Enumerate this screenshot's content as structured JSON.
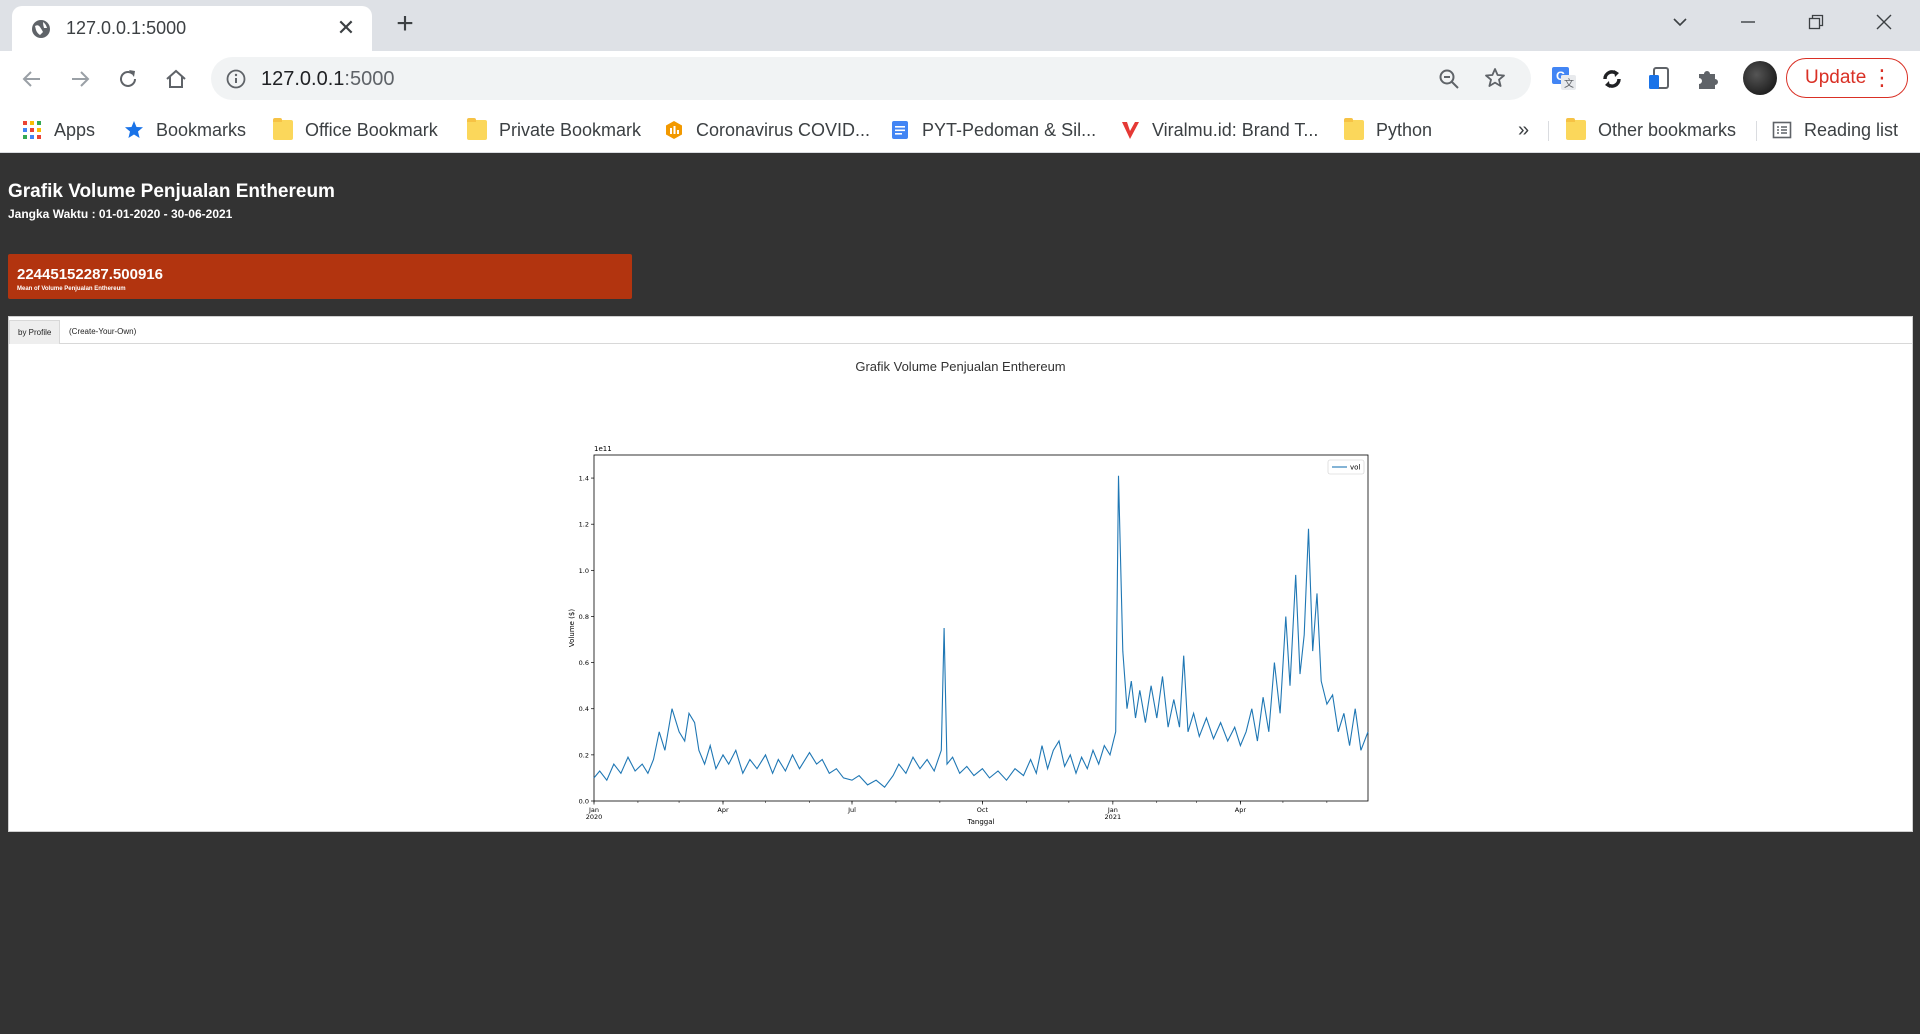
{
  "browser": {
    "tab_title": "127.0.0.1:5000",
    "url_host": "127.0.0.1",
    "url_port": ":5000",
    "update_label": "Update",
    "icons": {
      "favicon": "globe-icon",
      "close": "close-icon",
      "new_tab": "plus-icon",
      "back": "back-arrow-icon",
      "forward": "forward-arrow-icon",
      "reload": "reload-icon",
      "home": "home-icon",
      "info": "info-icon",
      "zoom": "zoom-out-icon",
      "star": "star-icon",
      "menu": "kebab-menu-icon"
    },
    "update_color": "#d93025"
  },
  "bookmarks": {
    "items": [
      {
        "label": "Apps",
        "icon": "apps-grid-icon"
      },
      {
        "label": "Bookmarks",
        "icon": "star-icon"
      },
      {
        "label": "Office Bookmark",
        "icon": "folder-icon"
      },
      {
        "label": "Private Bookmark",
        "icon": "folder-icon"
      },
      {
        "label": "Coronavirus COVID...",
        "icon": "dashboard-icon"
      },
      {
        "label": "PYT-Pedoman & Sil...",
        "icon": "docs-icon"
      },
      {
        "label": "Viralmu.id: Brand T...",
        "icon": "v-logo-icon"
      },
      {
        "label": "Python",
        "icon": "folder-icon"
      }
    ],
    "overflow": "»",
    "other": "Other bookmarks",
    "reading_list": "Reading list"
  },
  "page": {
    "title": "Grafik Volume Penjualan Enthereum",
    "subtitle": "Jangka Waktu : 01-01-2020 - 30-06-2021",
    "kpi": {
      "value": "22445152287.500916",
      "label": "Mean of Volume Penjualan Enthereum",
      "color": "#b2340f"
    },
    "tabs": [
      "by Profile",
      "(Create-Your-Own)"
    ],
    "chart_heading": "Grafik Volume Penjualan Enthereum",
    "background": "#333333"
  },
  "chart_data": {
    "type": "line",
    "xlabel": "Tanggal",
    "ylabel": "Volume ($)",
    "offset_label": "1e11",
    "x_range": [
      "2020-01-01",
      "2021-06-30"
    ],
    "ylim": [
      0,
      0.15
    ],
    "y_ticks": [
      "0.0",
      "0.2",
      "0.4",
      "0.6",
      "0.8",
      "1.0",
      "1.2",
      "1.4"
    ],
    "x_ticks": [
      {
        "date": "2020-01-01",
        "label": "Jan",
        "sub": "2020"
      },
      {
        "date": "2020-04-01",
        "label": "Apr",
        "sub": ""
      },
      {
        "date": "2020-07-01",
        "label": "Jul",
        "sub": ""
      },
      {
        "date": "2020-10-01",
        "label": "Oct",
        "sub": ""
      },
      {
        "date": "2021-01-01",
        "label": "Jan",
        "sub": "2021"
      },
      {
        "date": "2021-04-01",
        "label": "Apr",
        "sub": ""
      }
    ],
    "legend": "top-right",
    "grid": false,
    "series": [
      {
        "name": "vol",
        "color": "#1f77b4",
        "points": [
          [
            "2020-01-01",
            0.01
          ],
          [
            "2020-01-05",
            0.013
          ],
          [
            "2020-01-10",
            0.009
          ],
          [
            "2020-01-15",
            0.016
          ],
          [
            "2020-01-20",
            0.012
          ],
          [
            "2020-01-25",
            0.019
          ],
          [
            "2020-01-30",
            0.013
          ],
          [
            "2020-02-04",
            0.016
          ],
          [
            "2020-02-08",
            0.012
          ],
          [
            "2020-02-12",
            0.018
          ],
          [
            "2020-02-16",
            0.03
          ],
          [
            "2020-02-20",
            0.022
          ],
          [
            "2020-02-25",
            0.04
          ],
          [
            "2020-03-01",
            0.03
          ],
          [
            "2020-03-05",
            0.026
          ],
          [
            "2020-03-08",
            0.038
          ],
          [
            "2020-03-12",
            0.034
          ],
          [
            "2020-03-15",
            0.022
          ],
          [
            "2020-03-19",
            0.016
          ],
          [
            "2020-03-23",
            0.024
          ],
          [
            "2020-03-27",
            0.014
          ],
          [
            "2020-04-01",
            0.02
          ],
          [
            "2020-04-05",
            0.016
          ],
          [
            "2020-04-10",
            0.022
          ],
          [
            "2020-04-15",
            0.012
          ],
          [
            "2020-04-20",
            0.018
          ],
          [
            "2020-04-25",
            0.014
          ],
          [
            "2020-05-01",
            0.02
          ],
          [
            "2020-05-06",
            0.012
          ],
          [
            "2020-05-10",
            0.018
          ],
          [
            "2020-05-15",
            0.013
          ],
          [
            "2020-05-20",
            0.02
          ],
          [
            "2020-05-25",
            0.014
          ],
          [
            "2020-06-01",
            0.021
          ],
          [
            "2020-06-06",
            0.016
          ],
          [
            "2020-06-10",
            0.018
          ],
          [
            "2020-06-15",
            0.012
          ],
          [
            "2020-06-20",
            0.014
          ],
          [
            "2020-06-25",
            0.01
          ],
          [
            "2020-07-01",
            0.009
          ],
          [
            "2020-07-06",
            0.011
          ],
          [
            "2020-07-12",
            0.007
          ],
          [
            "2020-07-18",
            0.009
          ],
          [
            "2020-07-24",
            0.006
          ],
          [
            "2020-07-30",
            0.011
          ],
          [
            "2020-08-03",
            0.016
          ],
          [
            "2020-08-08",
            0.012
          ],
          [
            "2020-08-13",
            0.019
          ],
          [
            "2020-08-18",
            0.014
          ],
          [
            "2020-08-23",
            0.018
          ],
          [
            "2020-08-28",
            0.013
          ],
          [
            "2020-09-02",
            0.022
          ],
          [
            "2020-09-04",
            0.075
          ],
          [
            "2020-09-06",
            0.016
          ],
          [
            "2020-09-10",
            0.019
          ],
          [
            "2020-09-15",
            0.012
          ],
          [
            "2020-09-20",
            0.015
          ],
          [
            "2020-09-25",
            0.011
          ],
          [
            "2020-10-01",
            0.014
          ],
          [
            "2020-10-06",
            0.01
          ],
          [
            "2020-10-12",
            0.013
          ],
          [
            "2020-10-18",
            0.009
          ],
          [
            "2020-10-24",
            0.014
          ],
          [
            "2020-10-30",
            0.011
          ],
          [
            "2020-11-04",
            0.018
          ],
          [
            "2020-11-08",
            0.012
          ],
          [
            "2020-11-12",
            0.024
          ],
          [
            "2020-11-16",
            0.014
          ],
          [
            "2020-11-20",
            0.022
          ],
          [
            "2020-11-24",
            0.026
          ],
          [
            "2020-11-28",
            0.015
          ],
          [
            "2020-12-02",
            0.02
          ],
          [
            "2020-12-06",
            0.012
          ],
          [
            "2020-12-10",
            0.019
          ],
          [
            "2020-12-14",
            0.014
          ],
          [
            "2020-12-18",
            0.022
          ],
          [
            "2020-12-22",
            0.016
          ],
          [
            "2020-12-26",
            0.024
          ],
          [
            "2020-12-30",
            0.02
          ],
          [
            "2021-01-03",
            0.03
          ],
          [
            "2021-01-05",
            0.141
          ],
          [
            "2021-01-08",
            0.065
          ],
          [
            "2021-01-11",
            0.04
          ],
          [
            "2021-01-14",
            0.052
          ],
          [
            "2021-01-17",
            0.036
          ],
          [
            "2021-01-20",
            0.048
          ],
          [
            "2021-01-24",
            0.034
          ],
          [
            "2021-01-28",
            0.05
          ],
          [
            "2021-02-01",
            0.036
          ],
          [
            "2021-02-05",
            0.054
          ],
          [
            "2021-02-09",
            0.032
          ],
          [
            "2021-02-13",
            0.044
          ],
          [
            "2021-02-17",
            0.032
          ],
          [
            "2021-02-20",
            0.063
          ],
          [
            "2021-02-23",
            0.03
          ],
          [
            "2021-02-27",
            0.038
          ],
          [
            "2021-03-03",
            0.028
          ],
          [
            "2021-03-08",
            0.036
          ],
          [
            "2021-03-13",
            0.027
          ],
          [
            "2021-03-18",
            0.034
          ],
          [
            "2021-03-23",
            0.026
          ],
          [
            "2021-03-28",
            0.032
          ],
          [
            "2021-04-01",
            0.024
          ],
          [
            "2021-04-05",
            0.03
          ],
          [
            "2021-04-09",
            0.04
          ],
          [
            "2021-04-13",
            0.026
          ],
          [
            "2021-04-17",
            0.045
          ],
          [
            "2021-04-21",
            0.03
          ],
          [
            "2021-04-25",
            0.06
          ],
          [
            "2021-04-29",
            0.038
          ],
          [
            "2021-05-03",
            0.08
          ],
          [
            "2021-05-06",
            0.05
          ],
          [
            "2021-05-10",
            0.098
          ],
          [
            "2021-05-13",
            0.055
          ],
          [
            "2021-05-16",
            0.072
          ],
          [
            "2021-05-19",
            0.118
          ],
          [
            "2021-05-22",
            0.065
          ],
          [
            "2021-05-25",
            0.09
          ],
          [
            "2021-05-28",
            0.052
          ],
          [
            "2021-06-01",
            0.042
          ],
          [
            "2021-06-05",
            0.046
          ],
          [
            "2021-06-09",
            0.03
          ],
          [
            "2021-06-13",
            0.038
          ],
          [
            "2021-06-17",
            0.024
          ],
          [
            "2021-06-21",
            0.04
          ],
          [
            "2021-06-25",
            0.022
          ],
          [
            "2021-06-30",
            0.03
          ]
        ]
      }
    ]
  }
}
